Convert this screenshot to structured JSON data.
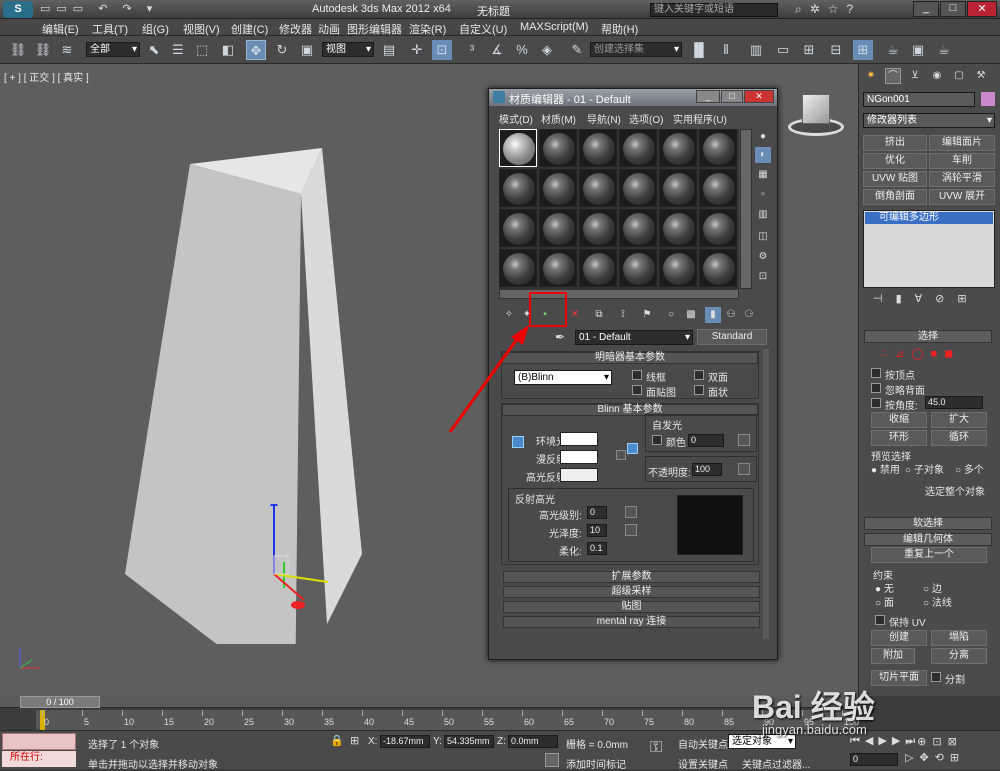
{
  "title": {
    "app": "Autodesk 3ds Max  2012 x64",
    "file": "无标题",
    "search_placeholder": "键入关键字或短语"
  },
  "menu": [
    "编辑(E)",
    "工具(T)",
    "组(G)",
    "视图(V)",
    "创建(C)",
    "修改器",
    "动画",
    "图形编辑器",
    "渲染(R)",
    "自定义(U)",
    "MAXScript(M)",
    "帮助(H)"
  ],
  "toolbar": {
    "selection_filter": "全部",
    "ref_coord": "视图",
    "named_selection": "创建选择集"
  },
  "viewport": {
    "label": "[ + ] [ 正交 ] [ 真实 ]"
  },
  "material_editor": {
    "title": "材质编辑器 - 01 - Default",
    "menus": [
      "模式(D)",
      "材质(M)",
      "导航(N)",
      "选项(O)",
      "实用程序(U)"
    ],
    "material_name": "01 - Default",
    "material_type": "Standard",
    "shader_rollout": "明暗器基本参数",
    "shader": "(B)Blinn",
    "wire": "线框",
    "two_sided": "双面",
    "face_map": "面贴图",
    "faceted": "面状",
    "blinn_rollout": "Blinn 基本参数",
    "self_illum": "自发光",
    "color": "颜色",
    "self_illum_value": "0",
    "ambient": "环境光:",
    "diffuse": "漫反射:",
    "specular": "高光反射:",
    "opacity": "不透明度:",
    "opacity_value": "100",
    "spec_highlights": "反射高光",
    "spec_level": "高光级别:",
    "spec_level_value": "0",
    "glossiness": "光泽度:",
    "glossiness_value": "10",
    "soften": "柔化:",
    "soften_value": "0.1",
    "rollouts": [
      "扩展参数",
      "超级采样",
      "贴图",
      "mental ray 连接"
    ]
  },
  "command_panel": {
    "object_name": "NGon001",
    "modifier_list": "修改器列表",
    "buttons": [
      "挤出",
      "编辑面片",
      "优化",
      "车削",
      "UVW 贴图",
      "涡轮平滑",
      "倒角剖面",
      "UVW 展开"
    ],
    "stack_item": "可编辑多边形",
    "selection": "选择",
    "by_vertex": "按顶点",
    "ignore_back": "忽略背面",
    "by_angle": "按角度:",
    "angle_value": "45.0",
    "shrink": "收缩",
    "grow": "扩大",
    "ring": "环形",
    "loop": "循环",
    "preview": "预览选择",
    "disable": "禁用",
    "subobj": "子对象",
    "multi": "多个",
    "whole": "选定整个对象",
    "soft_sel": "软选择",
    "edit_geo": "编辑几何体",
    "repeat": "重复上一个",
    "constraint": "约束",
    "none": "无",
    "edge": "边",
    "face": "面",
    "normal": "法线",
    "keep_uv": "保持 UV",
    "create": "创建",
    "collapse": "塌陷",
    "attach": "附加",
    "detach": "分离",
    "slice_plane": "切片平面",
    "split": "分割",
    "reset_plane": "重置平面",
    "cut": "切割"
  },
  "timeline": {
    "frame": "0 / 100",
    "ticks": [
      "0",
      "5",
      "10",
      "15",
      "20",
      "25",
      "30",
      "35",
      "40",
      "45",
      "50",
      "55",
      "60",
      "65",
      "70",
      "75",
      "80",
      "85",
      "90",
      "95",
      "100"
    ]
  },
  "status": {
    "in_progress": "所在行:",
    "selected": "选择了 1 个对象",
    "prompt": "单击并拖动以选择并移动对象",
    "x": "-18.67mm",
    "y": "54.335mm",
    "z": "0.0mm",
    "grid": "栅格 = 0.0mm",
    "add_tag": "添加时间标记",
    "auto_key": "自动关键点",
    "set_key": "设置关键点",
    "key_mode": "选定对象",
    "key_filter": "关键点过滤器...",
    "frame_field": "0"
  },
  "watermark": {
    "brand": "Bai 经验",
    "url": "jingyan.baidu.com"
  }
}
